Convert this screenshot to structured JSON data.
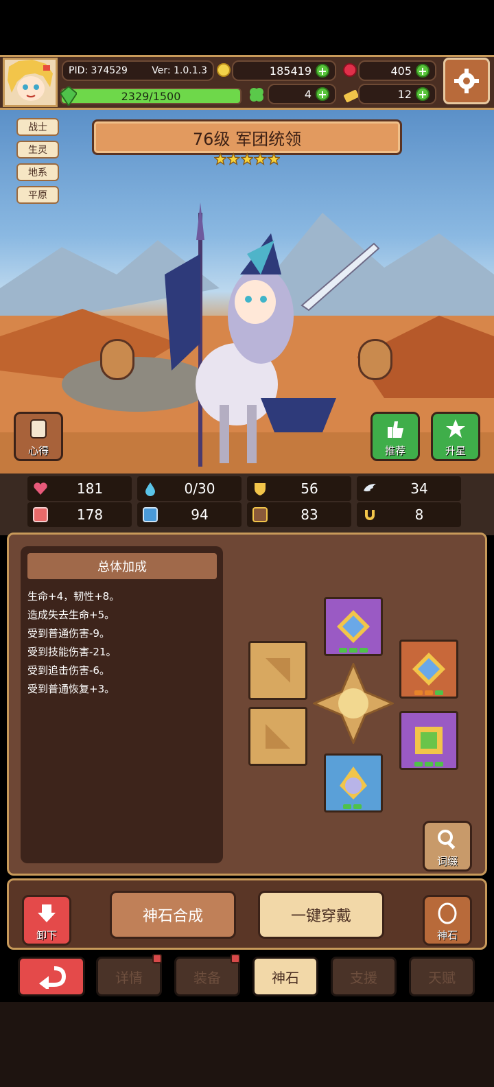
{
  "header": {
    "pid": "PID: 374529",
    "version": "Ver: 1.0.1.3",
    "gold": "185419",
    "gems": "405",
    "exp": "2329/1500",
    "clover": "4",
    "tickets": "12"
  },
  "hero": {
    "title": "76级 军团统领",
    "stars": 5,
    "tags": [
      "战士",
      "生灵",
      "地系",
      "平原"
    ],
    "buttons": {
      "notes": "心得",
      "recommend": "推荐",
      "star_up": "升星"
    }
  },
  "stats": {
    "hp": "181",
    "mana": "0/30",
    "defense": "56",
    "speed": "34",
    "attack": "178",
    "magic": "94",
    "armor": "83",
    "crit": "8"
  },
  "bonus_panel": {
    "title": "总体加成",
    "lines": [
      "生命+4，韧性+8。",
      "造成失去生命+5。",
      "受到普通伤害-9。",
      "受到技能伤害-21。",
      "受到追击伤害-6。",
      "受到普通恢复+3。"
    ]
  },
  "side_buttons": {
    "affix": "词缀",
    "unequip": "卸下",
    "godstone": "神石"
  },
  "actions": {
    "synthesize": "神石合成",
    "equip_all": "一键穿戴"
  },
  "nav": {
    "details": "详情",
    "equipment": "装备",
    "godstone": "神石",
    "support": "支援",
    "talent": "天赋"
  },
  "colors": {
    "accent": "#c89a5a",
    "green": "#58c33a",
    "panel": "#6e4735"
  }
}
